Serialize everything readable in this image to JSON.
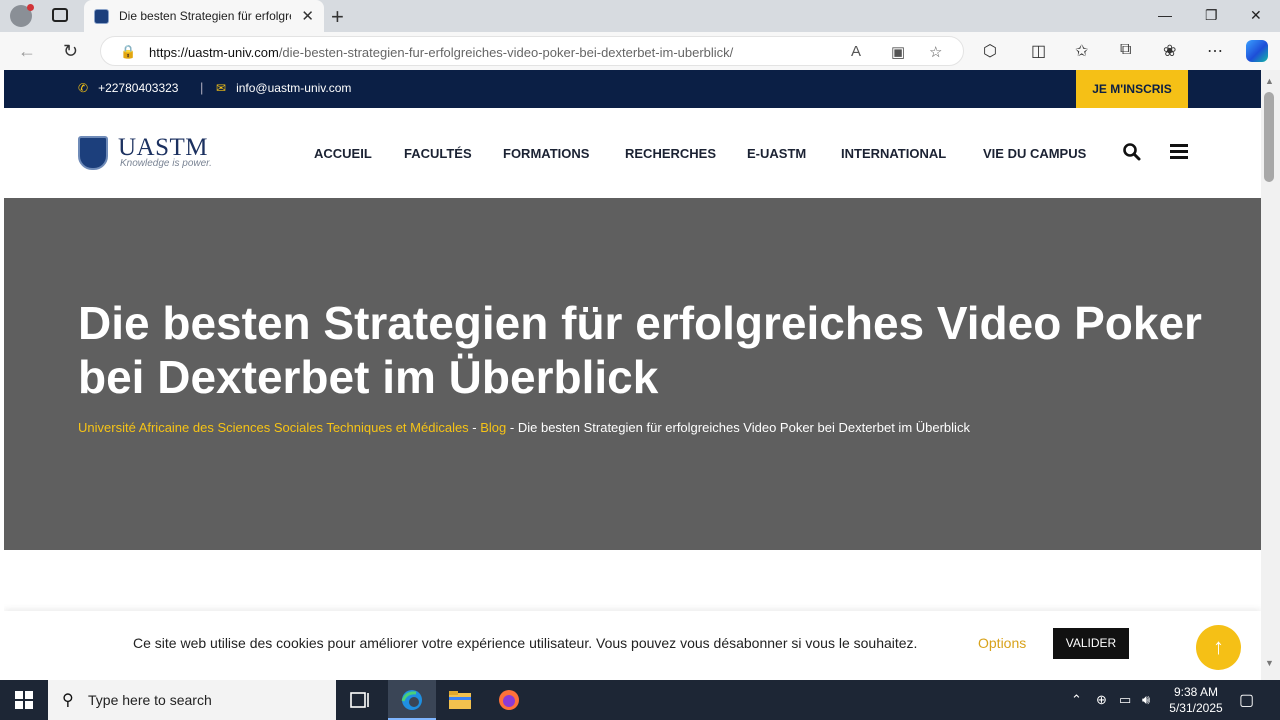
{
  "browser": {
    "tab_title": "Die besten Strategien für erfolgreiches Video Poker bei Dexterbet im Überblick",
    "url_host": "https://uastm-univ.com",
    "url_path": "/die-besten-strategien-fur-erfolgreiches-video-poker-bei-dexterbet-im-uberblick/"
  },
  "topbar": {
    "phone": "+22780403323",
    "separator": "|",
    "email": "info@uastm-univ.com",
    "cta": "JE M'INSCRIS"
  },
  "logo": {
    "name": "UASTM",
    "tagline": "Knowledge is power."
  },
  "menu": [
    "ACCUEIL",
    "FACULTÉS",
    "FORMATIONS",
    "RECHERCHES",
    "E-UASTM",
    "INTERNATIONAL",
    "VIE DU CAMPUS"
  ],
  "hero": {
    "title": "Die besten Strategien für erfolgreiches Video Poker bei Dexterbet im Überblick",
    "breadcrumb": {
      "home": "Université Africaine des Sciences Sociales Techniques et Médicales",
      "sep": " - ",
      "blog": "Blog",
      "current": "Die besten Strategien für erfolgreiches Video Poker bei Dexterbet im Überblick"
    }
  },
  "cookie": {
    "text": "Ce site web utilise des cookies pour améliorer votre expérience utilisateur. Vous pouvez vous désabonner si vous le souhaitez.",
    "options": "Options",
    "accept": "VALIDER"
  },
  "taskbar": {
    "search_placeholder": "Type here to search",
    "time": "9:38 AM",
    "date": "5/31/2025"
  },
  "colors": {
    "navy": "#0b1f45",
    "accent_yellow": "#f5c016",
    "hero_gray": "#5f5f5f"
  }
}
